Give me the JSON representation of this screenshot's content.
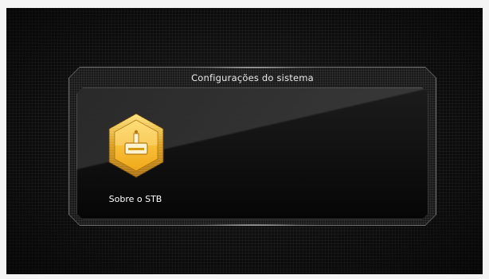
{
  "window": {
    "title": "Configurações do sistema"
  },
  "menu": {
    "items": [
      {
        "label": "Sobre o STB",
        "icon": "info-box-icon",
        "selected": true
      }
    ]
  },
  "colors": {
    "background": "#0e0e0e",
    "accent": "#f2b21c",
    "frame": "#6f6f6f",
    "text": "#e9e9e9"
  }
}
